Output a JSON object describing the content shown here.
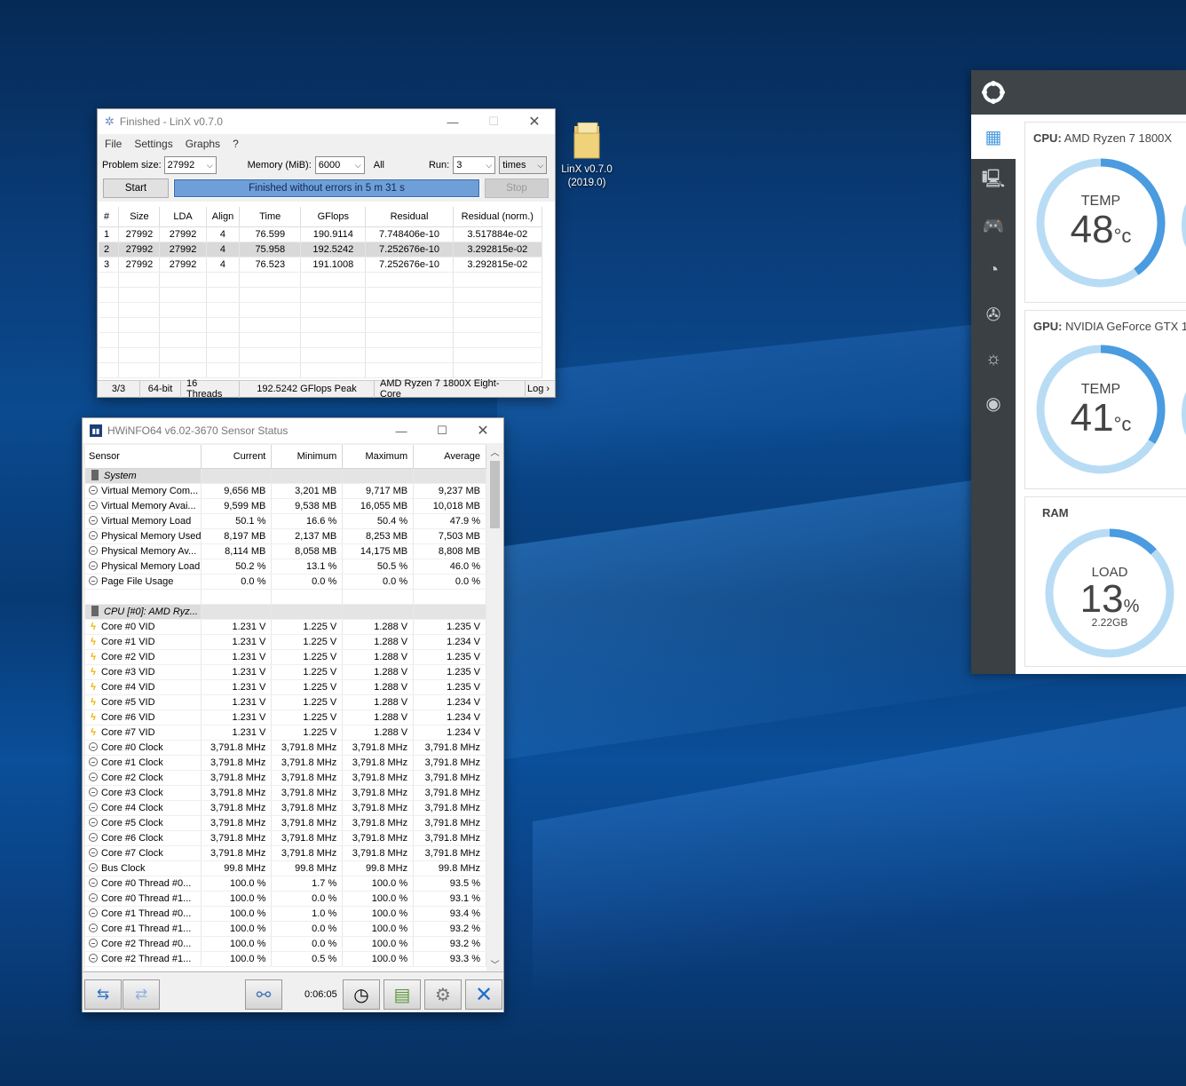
{
  "desktop_icon": {
    "label_line1": "LinX v0.7.0",
    "label_line2": "(2019.0)"
  },
  "linx": {
    "title": "Finished - LinX v0.7.0",
    "menu": [
      "File",
      "Settings",
      "Graphs",
      "?"
    ],
    "problem_size_label": "Problem size:",
    "problem_size_value": "27992",
    "memory_label": "Memory (MiB):",
    "memory_value": "6000",
    "all_label": "All",
    "run_label": "Run:",
    "run_value": "3",
    "times_value": "times",
    "start_label": "Start",
    "stop_label": "Stop",
    "progress_text": "Finished without errors in 5 m 31 s",
    "progress_fraction": 1.0,
    "columns": [
      "#",
      "Size",
      "LDA",
      "Align",
      "Time",
      "GFlops",
      "Residual",
      "Residual (norm.)"
    ],
    "rows": [
      [
        "1",
        "27992",
        "27992",
        "4",
        "76.599",
        "190.9114",
        "7.748406e-10",
        "3.517884e-02"
      ],
      [
        "2",
        "27992",
        "27992",
        "4",
        "75.958",
        "192.5242",
        "7.252676e-10",
        "3.292815e-02"
      ],
      [
        "3",
        "27992",
        "27992",
        "4",
        "76.523",
        "191.1008",
        "7.252676e-10",
        "3.292815e-02"
      ]
    ],
    "status": [
      "3/3",
      "64-bit",
      "16 Threads",
      "192.5242 GFlops Peak",
      "AMD Ryzen 7 1800X Eight-Core",
      "Log ›"
    ]
  },
  "hwinfo": {
    "title": "HWiNFO64 v6.02-3670 Sensor Status",
    "columns": [
      "Sensor",
      "Current",
      "Minimum",
      "Maximum",
      "Average"
    ],
    "rows": [
      {
        "t": "grp",
        "name": "System"
      },
      {
        "t": "min",
        "name": "Virtual Memory Com...",
        "v": [
          "9,656 MB",
          "3,201 MB",
          "9,717 MB",
          "9,237 MB"
        ]
      },
      {
        "t": "min",
        "name": "Virtual Memory Avai...",
        "v": [
          "9,599 MB",
          "9,538 MB",
          "16,055 MB",
          "10,018 MB"
        ]
      },
      {
        "t": "min",
        "name": "Virtual Memory Load",
        "v": [
          "50.1 %",
          "16.6 %",
          "50.4 %",
          "47.9 %"
        ]
      },
      {
        "t": "min",
        "name": "Physical Memory Used",
        "v": [
          "8,197 MB",
          "2,137 MB",
          "8,253 MB",
          "7,503 MB"
        ]
      },
      {
        "t": "min",
        "name": "Physical Memory Av...",
        "v": [
          "8,114 MB",
          "8,058 MB",
          "14,175 MB",
          "8,808 MB"
        ]
      },
      {
        "t": "min",
        "name": "Physical Memory Load",
        "v": [
          "50.2 %",
          "13.1 %",
          "50.5 %",
          "46.0 %"
        ]
      },
      {
        "t": "min",
        "name": "Page File Usage",
        "v": [
          "0.0 %",
          "0.0 %",
          "0.0 %",
          "0.0 %"
        ]
      },
      {
        "t": "blank"
      },
      {
        "t": "grp",
        "name": "CPU [#0]: AMD Ryz..."
      },
      {
        "t": "bolt",
        "name": "Core #0 VID",
        "v": [
          "1.231 V",
          "1.225 V",
          "1.288 V",
          "1.235 V"
        ]
      },
      {
        "t": "bolt",
        "name": "Core #1 VID",
        "v": [
          "1.231 V",
          "1.225 V",
          "1.288 V",
          "1.234 V"
        ]
      },
      {
        "t": "bolt",
        "name": "Core #2 VID",
        "v": [
          "1.231 V",
          "1.225 V",
          "1.288 V",
          "1.235 V"
        ]
      },
      {
        "t": "bolt",
        "name": "Core #3 VID",
        "v": [
          "1.231 V",
          "1.225 V",
          "1.288 V",
          "1.235 V"
        ]
      },
      {
        "t": "bolt",
        "name": "Core #4 VID",
        "v": [
          "1.231 V",
          "1.225 V",
          "1.288 V",
          "1.235 V"
        ]
      },
      {
        "t": "bolt",
        "name": "Core #5 VID",
        "v": [
          "1.231 V",
          "1.225 V",
          "1.288 V",
          "1.234 V"
        ]
      },
      {
        "t": "bolt",
        "name": "Core #6 VID",
        "v": [
          "1.231 V",
          "1.225 V",
          "1.288 V",
          "1.234 V"
        ]
      },
      {
        "t": "bolt",
        "name": "Core #7 VID",
        "v": [
          "1.231 V",
          "1.225 V",
          "1.288 V",
          "1.234 V"
        ]
      },
      {
        "t": "min",
        "name": "Core #0 Clock",
        "v": [
          "3,791.8 MHz",
          "3,791.8 MHz",
          "3,791.8 MHz",
          "3,791.8 MHz"
        ]
      },
      {
        "t": "min",
        "name": "Core #1 Clock",
        "v": [
          "3,791.8 MHz",
          "3,791.8 MHz",
          "3,791.8 MHz",
          "3,791.8 MHz"
        ]
      },
      {
        "t": "min",
        "name": "Core #2 Clock",
        "v": [
          "3,791.8 MHz",
          "3,791.8 MHz",
          "3,791.8 MHz",
          "3,791.8 MHz"
        ]
      },
      {
        "t": "min",
        "name": "Core #3 Clock",
        "v": [
          "3,791.8 MHz",
          "3,791.8 MHz",
          "3,791.8 MHz",
          "3,791.8 MHz"
        ]
      },
      {
        "t": "min",
        "name": "Core #4 Clock",
        "v": [
          "3,791.8 MHz",
          "3,791.8 MHz",
          "3,791.8 MHz",
          "3,791.8 MHz"
        ]
      },
      {
        "t": "min",
        "name": "Core #5 Clock",
        "v": [
          "3,791.8 MHz",
          "3,791.8 MHz",
          "3,791.8 MHz",
          "3,791.8 MHz"
        ]
      },
      {
        "t": "min",
        "name": "Core #6 Clock",
        "v": [
          "3,791.8 MHz",
          "3,791.8 MHz",
          "3,791.8 MHz",
          "3,791.8 MHz"
        ]
      },
      {
        "t": "min",
        "name": "Core #7 Clock",
        "v": [
          "3,791.8 MHz",
          "3,791.8 MHz",
          "3,791.8 MHz",
          "3,791.8 MHz"
        ]
      },
      {
        "t": "min",
        "name": "Bus Clock",
        "v": [
          "99.8 MHz",
          "99.8 MHz",
          "99.8 MHz",
          "99.8 MHz"
        ]
      },
      {
        "t": "min",
        "name": "Core #0 Thread #0...",
        "v": [
          "100.0 %",
          "1.7 %",
          "100.0 %",
          "93.5 %"
        ]
      },
      {
        "t": "min",
        "name": "Core #0 Thread #1...",
        "v": [
          "100.0 %",
          "0.0 %",
          "100.0 %",
          "93.1 %"
        ]
      },
      {
        "t": "min",
        "name": "Core #1 Thread #0...",
        "v": [
          "100.0 %",
          "1.0 %",
          "100.0 %",
          "93.4 %"
        ]
      },
      {
        "t": "min",
        "name": "Core #1 Thread #1...",
        "v": [
          "100.0 %",
          "0.0 %",
          "100.0 %",
          "93.2 %"
        ]
      },
      {
        "t": "min",
        "name": "Core #2 Thread #0...",
        "v": [
          "100.0 %",
          "0.0 %",
          "100.0 %",
          "93.2 %"
        ]
      },
      {
        "t": "min",
        "name": "Core #2 Thread #1...",
        "v": [
          "100.0 %",
          "0.5 %",
          "100.0 %",
          "93.3 %"
        ]
      }
    ],
    "timer": "0:06:05"
  },
  "monitor": {
    "cpu_prefix": "CPU:",
    "cpu_name": "AMD Ryzen 7 1800X",
    "cpu_temp_label": "TEMP",
    "cpu_temp_value": "48",
    "cpu_temp_unit": "°c",
    "cpu_temp_fraction": 0.4,
    "gpu_prefix": "GPU:",
    "gpu_name": "NVIDIA GeForce GTX 1",
    "gpu_temp_label": "TEMP",
    "gpu_temp_value": "41",
    "gpu_temp_unit": "°c",
    "gpu_temp_fraction": 0.34,
    "ram_label": "RAM",
    "ram_load_label": "LOAD",
    "ram_load_value": "13",
    "ram_load_unit": "%",
    "ram_used": "2.22GB",
    "ram_load_fraction": 0.13,
    "accent_color": "#4a9be0",
    "track_color": "#b9dcf5"
  }
}
